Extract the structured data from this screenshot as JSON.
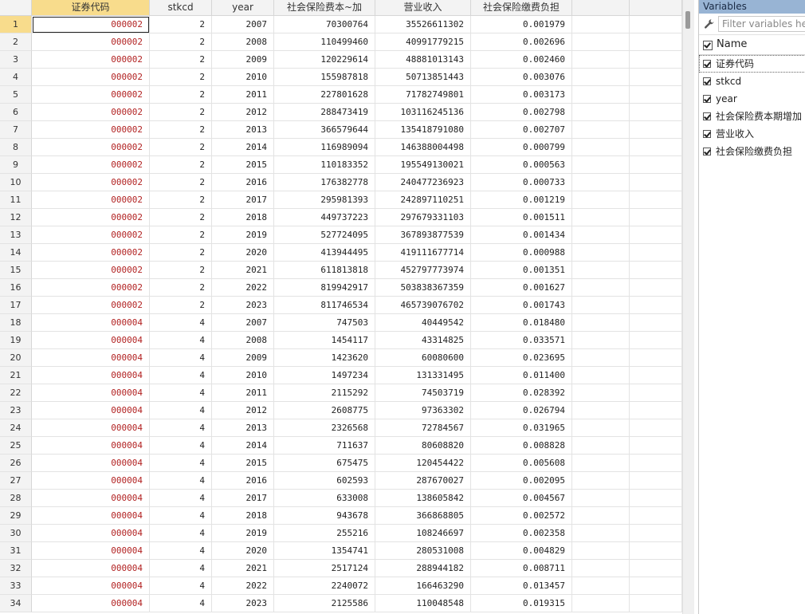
{
  "columns": [
    "",
    "证券代码",
    "stkcd",
    "year",
    "社会保险费本~加",
    "营业收入",
    "社会保险缴费负担",
    "",
    ""
  ],
  "rows": [
    [
      "1",
      "000002",
      "2",
      "2007",
      "70300764",
      "35526611302",
      "0.001979"
    ],
    [
      "2",
      "000002",
      "2",
      "2008",
      "110499460",
      "40991779215",
      "0.002696"
    ],
    [
      "3",
      "000002",
      "2",
      "2009",
      "120229614",
      "48881013143",
      "0.002460"
    ],
    [
      "4",
      "000002",
      "2",
      "2010",
      "155987818",
      "50713851443",
      "0.003076"
    ],
    [
      "5",
      "000002",
      "2",
      "2011",
      "227801628",
      "71782749801",
      "0.003173"
    ],
    [
      "6",
      "000002",
      "2",
      "2012",
      "288473419",
      "103116245136",
      "0.002798"
    ],
    [
      "7",
      "000002",
      "2",
      "2013",
      "366579644",
      "135418791080",
      "0.002707"
    ],
    [
      "8",
      "000002",
      "2",
      "2014",
      "116989094",
      "146388004498",
      "0.000799"
    ],
    [
      "9",
      "000002",
      "2",
      "2015",
      "110183352",
      "195549130021",
      "0.000563"
    ],
    [
      "10",
      "000002",
      "2",
      "2016",
      "176382778",
      "240477236923",
      "0.000733"
    ],
    [
      "11",
      "000002",
      "2",
      "2017",
      "295981393",
      "242897110251",
      "0.001219"
    ],
    [
      "12",
      "000002",
      "2",
      "2018",
      "449737223",
      "297679331103",
      "0.001511"
    ],
    [
      "13",
      "000002",
      "2",
      "2019",
      "527724095",
      "367893877539",
      "0.001434"
    ],
    [
      "14",
      "000002",
      "2",
      "2020",
      "413944495",
      "419111677714",
      "0.000988"
    ],
    [
      "15",
      "000002",
      "2",
      "2021",
      "611813818",
      "452797773974",
      "0.001351"
    ],
    [
      "16",
      "000002",
      "2",
      "2022",
      "819942917",
      "503838367359",
      "0.001627"
    ],
    [
      "17",
      "000002",
      "2",
      "2023",
      "811746534",
      "465739076702",
      "0.001743"
    ],
    [
      "18",
      "000004",
      "4",
      "2007",
      "747503",
      "40449542",
      "0.018480"
    ],
    [
      "19",
      "000004",
      "4",
      "2008",
      "1454117",
      "43314825",
      "0.033571"
    ],
    [
      "20",
      "000004",
      "4",
      "2009",
      "1423620",
      "60080600",
      "0.023695"
    ],
    [
      "21",
      "000004",
      "4",
      "2010",
      "1497234",
      "131331495",
      "0.011400"
    ],
    [
      "22",
      "000004",
      "4",
      "2011",
      "2115292",
      "74503719",
      "0.028392"
    ],
    [
      "23",
      "000004",
      "4",
      "2012",
      "2608775",
      "97363302",
      "0.026794"
    ],
    [
      "24",
      "000004",
      "4",
      "2013",
      "2326568",
      "72784567",
      "0.031965"
    ],
    [
      "25",
      "000004",
      "4",
      "2014",
      "711637",
      "80608820",
      "0.008828"
    ],
    [
      "26",
      "000004",
      "4",
      "2015",
      "675475",
      "120454422",
      "0.005608"
    ],
    [
      "27",
      "000004",
      "4",
      "2016",
      "602593",
      "287670027",
      "0.002095"
    ],
    [
      "28",
      "000004",
      "4",
      "2017",
      "633008",
      "138605842",
      "0.004567"
    ],
    [
      "29",
      "000004",
      "4",
      "2018",
      "943678",
      "366868805",
      "0.002572"
    ],
    [
      "30",
      "000004",
      "4",
      "2019",
      "255216",
      "108246697",
      "0.002358"
    ],
    [
      "31",
      "000004",
      "4",
      "2020",
      "1354741",
      "280531008",
      "0.004829"
    ],
    [
      "32",
      "000004",
      "4",
      "2021",
      "2517124",
      "288944182",
      "0.008711"
    ],
    [
      "33",
      "000004",
      "4",
      "2022",
      "2240072",
      "166463290",
      "0.013457"
    ],
    [
      "34",
      "000004",
      "4",
      "2023",
      "2125586",
      "110048548",
      "0.019315"
    ]
  ],
  "selected_row": 1,
  "selected_column": 1,
  "variables_panel": {
    "title": "Variables",
    "filter_placeholder": "Filter variables here",
    "name_header": "Name",
    "items": [
      "证券代码",
      "stkcd",
      "year",
      "社会保险费本期增加",
      "营业收入",
      "社会保险缴费负担"
    ]
  },
  "colors": {
    "highlight": "#f8dc8c",
    "code_text": "#b22222",
    "panel_title": "#98b4d4"
  },
  "icons": {
    "filter": "wrench-icon",
    "checkbox": "checkbox-checked-icon"
  }
}
